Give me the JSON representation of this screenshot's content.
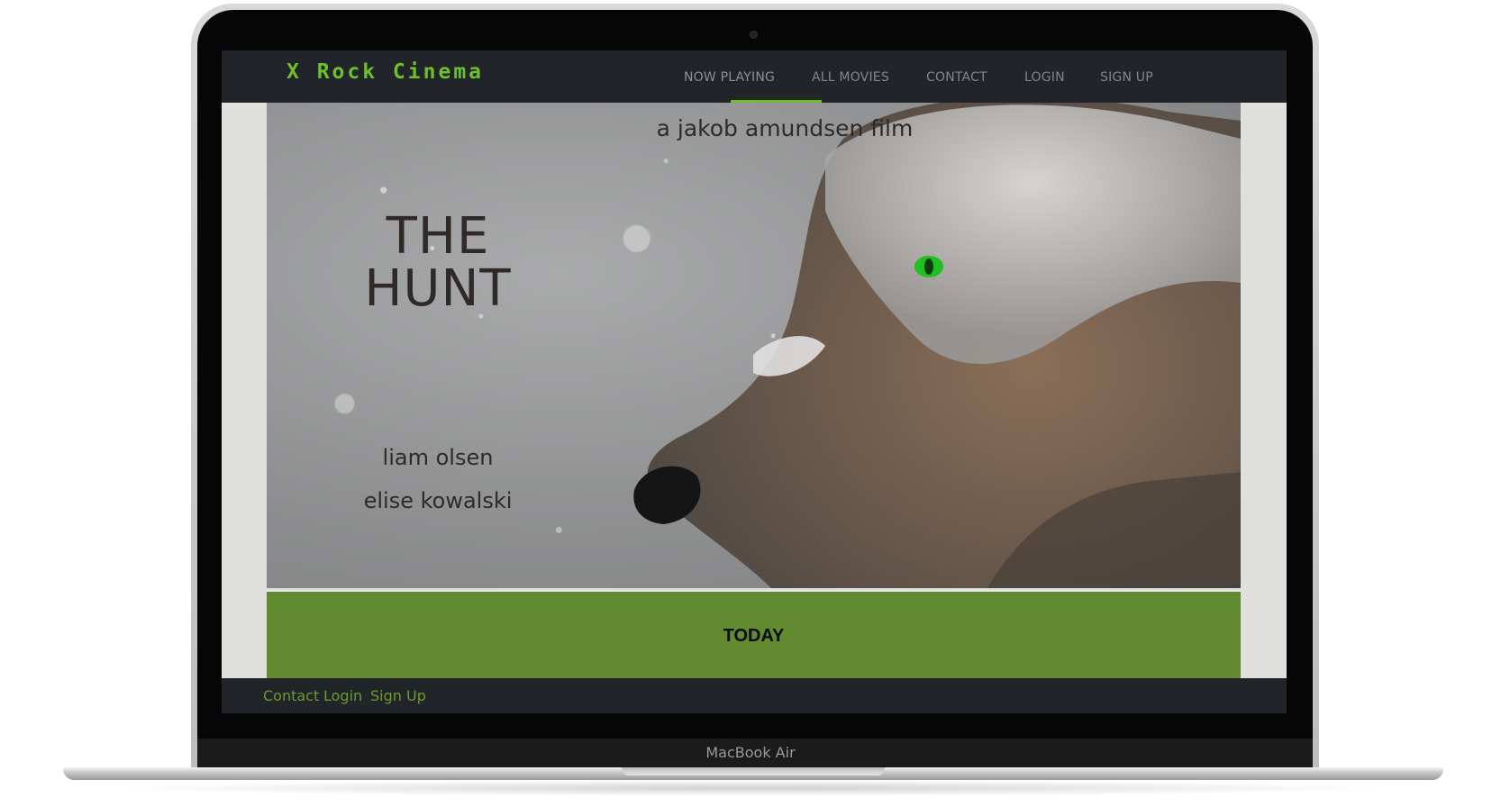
{
  "device": {
    "label": "MacBook Air"
  },
  "site": {
    "logo": "X Rock Cinema",
    "nav": [
      {
        "label": "NOW PLAYING",
        "active": true
      },
      {
        "label": "ALL MOVIES",
        "active": false
      },
      {
        "label": "CONTACT",
        "active": false
      },
      {
        "label": "LOGIN",
        "active": false
      },
      {
        "label": "SIGN UP",
        "active": false
      }
    ]
  },
  "hero": {
    "tagline": "a jakob amundsen film",
    "title_line1": "THE",
    "title_line2": "HUNT",
    "cast": [
      "liam olsen",
      "elise kowalski"
    ]
  },
  "showtimes": {
    "label": "TODAY"
  },
  "footer": {
    "links": [
      "Contact",
      "Login",
      "Sign Up"
    ]
  },
  "colors": {
    "accent": "#6fbf2a",
    "navbar_bg": "#212529",
    "today_bg": "#628a31",
    "page_bg": "#dfe0dc"
  }
}
